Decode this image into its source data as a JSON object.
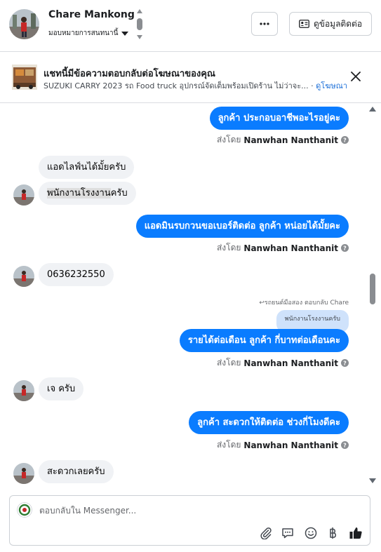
{
  "header": {
    "contact_name": "Chare Mankong",
    "assign_label": "มอบหมายการสนทนานี้",
    "more_label": "···",
    "contact_info_label": "ดูข้อมูลติดต่อ"
  },
  "ad_banner": {
    "title": "แชทนี้มีข้อความตอบกลับต่อโฆษณาของคุณ",
    "subtitle": "SUZUKI CARRY 2023 รถ Food truck อุปกรณ์จัดเต็มพร้อมเปิดร้าน ไม่ว่าจะ...",
    "link_label": "ดูโฆษณา"
  },
  "messages": [
    {
      "dir": "out",
      "text": "ลูกค้า ประกอบอาชีพอะไรอยู่คะ"
    },
    {
      "dir": "out_meta",
      "prefix": "ส่งโดย",
      "sender": "Nanwhan Nanthanit"
    },
    {
      "dir": "in",
      "text": "แอดไลฟ์นได้มั้ยครับ"
    },
    {
      "dir": "in",
      "text_highlight": "พนักงานโรงงาน",
      "text_rest": "ครับ"
    },
    {
      "dir": "out",
      "text": "แอดมินรบกวนขอเบอร์ติดต่อ ลูกค้า หน่อยได้มั้ยคะ"
    },
    {
      "dir": "out_meta",
      "prefix": "ส่งโดย",
      "sender": "Nanwhan Nanthanit"
    },
    {
      "dir": "in",
      "text": "0636232550"
    },
    {
      "dir": "reply_meta",
      "text": "↩รถยนต์มือสอง ตอบกลับ Chare"
    },
    {
      "dir": "quoted",
      "text": "พนักงานโรงงานครับ"
    },
    {
      "dir": "out",
      "text": "รายได้ต่อเดือน ลูกค้า กี่บาทต่อเดือนคะ"
    },
    {
      "dir": "out_meta",
      "prefix": "ส่งโดย",
      "sender": "Nanwhan Nanthanit"
    },
    {
      "dir": "in",
      "text": "เจ ครับ"
    },
    {
      "dir": "out",
      "text": "ลูกค้า สะดวกให้ติดต่อ ช่วงกี่โมงดีคะ"
    },
    {
      "dir": "out_meta",
      "prefix": "ส่งโดย",
      "sender": "Nanwhan Nanthanit"
    },
    {
      "dir": "in",
      "text": "สะดวกเลยครับ"
    }
  ],
  "composer": {
    "placeholder": "ตอบกลับใน Messenger..."
  },
  "icons": {
    "stepper": "up-down-arrows-icon",
    "more": "ellipsis-icon",
    "contact_card": "contact-card-icon",
    "close": "close-icon",
    "info": "info-icon",
    "attach": "paperclip-icon",
    "saved_replies": "speech-bubble-icon",
    "emoji": "smiley-icon",
    "currency": "baht-icon",
    "like": "thumbs-up-icon"
  },
  "colors": {
    "outgoing_bubble": "#0a7cff",
    "incoming_bubble": "#f0f2f5",
    "link": "#1a6ed8"
  }
}
